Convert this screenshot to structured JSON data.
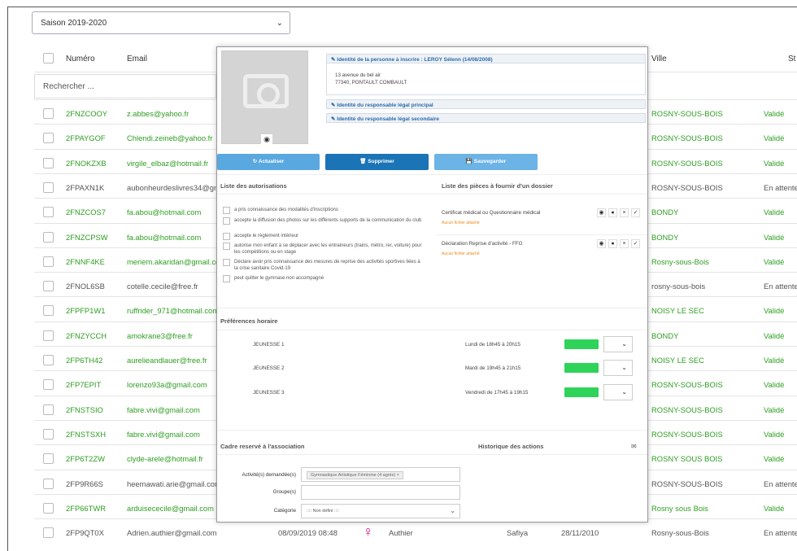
{
  "season": {
    "selected": "Saison 2019-2020"
  },
  "table": {
    "headers": {
      "numero": "Numéro",
      "email": "Email",
      "ville": "Ville",
      "statut": "St"
    },
    "search_placeholder": "Rechercher ...",
    "rows": [
      {
        "num": "2FNZCOOY",
        "email": "z.abbes@yahoo.fr",
        "ville": "ROSNY-SOUS-BOIS",
        "statut": "Validé",
        "green": true
      },
      {
        "num": "2FPAYGOF",
        "email": "Chlendi.zeineb@yahoo.fr",
        "ville": "ROSNY-SOUS-BOIS",
        "statut": "Validé",
        "green": true
      },
      {
        "num": "2FNOKZXB",
        "email": "virgile_elbaz@hotmail.fr",
        "ville": "ROSNY-SOUS-BOIS",
        "statut": "Validé",
        "green": true
      },
      {
        "num": "2FPAXN1K",
        "email": "aubonheurdeslivres34@gm",
        "ville": "ROSNY-SOUS-BOIS",
        "statut": "En attente",
        "green": false
      },
      {
        "num": "2FNZCOS7",
        "email": "fa.abou@hotmail.com",
        "ville": "BONDY",
        "statut": "Validé",
        "green": true
      },
      {
        "num": "2FNZCPSW",
        "email": "fa.abou@hotmail.com",
        "ville": "BONDY",
        "statut": "Validé",
        "green": true
      },
      {
        "num": "2FNNF4KE",
        "email": "meriem.akaridan@gmail.co",
        "ville": "Rosny-sous-Bois",
        "statut": "Validé",
        "green": true
      },
      {
        "num": "2FNOL6SB",
        "email": "cotelle.cecile@free.fr",
        "ville": "rosny-sous-bois",
        "statut": "En attente",
        "green": false
      },
      {
        "num": "2FPFP1W1",
        "email": "ruffrider_971@hotmail.com",
        "ville": "NOISY LE SEC",
        "statut": "Validé",
        "green": true
      },
      {
        "num": "2FNZYCCH",
        "email": "amokrane3@free.fr",
        "ville": "BONDY",
        "statut": "Validé",
        "green": true
      },
      {
        "num": "2FP6TH42",
        "email": "aurelieandlauer@free.fr",
        "ville": "NOISY LE SEC",
        "statut": "Validé",
        "green": true
      },
      {
        "num": "2FP7EPIT",
        "email": "lorenzo93a@gmail.com",
        "ville": "ROSNY-SOUS-BOIS",
        "statut": "Validé",
        "green": true
      },
      {
        "num": "2FNSTSIO",
        "email": "fabre.vivi@gmail.com",
        "ville": "ROSNY-SOUS-BOIS",
        "statut": "Validé",
        "green": true
      },
      {
        "num": "2FNSTSXH",
        "email": "fabre.vivi@gmail.com",
        "ville": "ROSNY-SOUS-BOIS",
        "statut": "Validé",
        "green": true
      },
      {
        "num": "2FP6T2ZW",
        "email": "clyde-arele@hotmail.fr",
        "ville": "ROSNY SOUS BOIS",
        "statut": "Validé",
        "green": true
      },
      {
        "num": "2FP9R66S",
        "email": "heemawati.arie@gmail.com",
        "ville": "ROSNY-SOUS-BOIS",
        "statut": "En attente",
        "green": false
      },
      {
        "num": "2FP66TWR",
        "email": "arduisececile@gmail.com",
        "ville": "Rosny sous Bois",
        "statut": "Validé",
        "green": true
      },
      {
        "num": "2FP9QT0X",
        "email": "Adrien.authier@gmail.com",
        "ville": "Rosny-sous-Bois",
        "statut": "En attente",
        "green": false
      }
    ],
    "last_row_extra": {
      "date": "08/09/2019 08:48",
      "nom": "Authier",
      "prenom": "Safiya",
      "naissance": "28/11/2010"
    }
  },
  "modal": {
    "identity_title": "Identité de la personne à inscrire : LEROY Sélenn (14/08/2008)",
    "address_line1": "13 avenue du bel air",
    "address_line2": "77340, PONTAULT COMBAULT",
    "legal_primary": "Identité du responsable légal principal",
    "legal_secondary": "Identité du responsable légal secondaire",
    "buttons": {
      "refresh": "Actualiser",
      "delete": "Supprimer",
      "save": "Sauvegarder"
    },
    "colors": {
      "refresh": "#5aa8e0",
      "delete": "#1a74b6",
      "save": "#6cb3e6"
    },
    "authorizations_title": "Liste des autorisations",
    "authorizations": [
      "a pris connaissance des modalités d'inscriptions",
      "accepte la diffusion des photos sur les différents supports de la communication du club",
      "accepte le règlement intérieur",
      "autorise mon enfant à se déplacer avec les entraineurs (trains, métro, rer, voiture) pour les compétitions ou en stage",
      "Déclare avoir pris connaissance des mesures de reprise des activités sportives liées à la crise sanitaire Covid-19",
      "peut quitter le gymnase non accompagné"
    ],
    "documents_title": "Liste des pièces à fournir d'un dossier",
    "documents": [
      {
        "label": "Certificat médical ou Questionnaire médical",
        "status": "Aucun fichier attaché"
      },
      {
        "label": "Déclaration Reprise d'activité - FFG",
        "status": "Aucun fichier attaché"
      }
    ],
    "preferences_title": "Préférences horaire",
    "preferences": [
      {
        "group": "JEUNESSE 1",
        "slot": "Lundi de 18h45 à 20h15"
      },
      {
        "group": "JEUNESSE 2",
        "slot": "Mardi de 19h45 à 21h15"
      },
      {
        "group": "JEUNESSE 3",
        "slot": "Vendredi de 17h45 à 19h15"
      }
    ],
    "association_title": "Cadre reservé à l'association",
    "history_title": "Historique des actions",
    "form": {
      "activities_label": "Activité(s) demandée(s)",
      "activities_tag": "Gymnastique Artistique Féminine (4 agrès)",
      "groups_label": "Groupe(s)",
      "category_label": "Catégorie",
      "category_value": ":::: Non défini ::::"
    }
  }
}
